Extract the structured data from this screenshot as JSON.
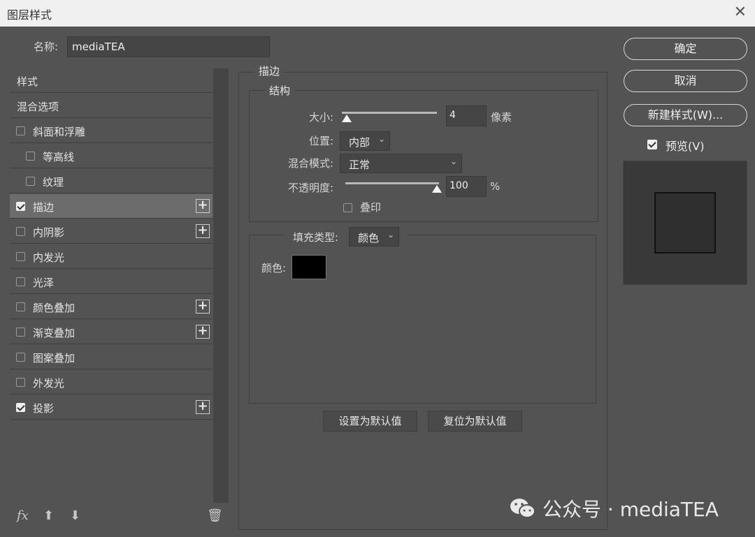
{
  "window": {
    "title": "图层样式",
    "close_glyph": "✕"
  },
  "name_row": {
    "label": "名称:",
    "value": "mediaTEA"
  },
  "style_list": {
    "items": [
      {
        "label": "样式",
        "checkbox": false,
        "checked": false,
        "plus": false,
        "selected": false,
        "indent": 0
      },
      {
        "label": "混合选项",
        "checkbox": false,
        "checked": false,
        "plus": false,
        "selected": false,
        "indent": 0
      },
      {
        "label": "斜面和浮雕",
        "checkbox": true,
        "checked": false,
        "plus": false,
        "selected": false,
        "indent": 0
      },
      {
        "label": "等高线",
        "checkbox": true,
        "checked": false,
        "plus": false,
        "selected": false,
        "indent": 1
      },
      {
        "label": "纹理",
        "checkbox": true,
        "checked": false,
        "plus": false,
        "selected": false,
        "indent": 1
      },
      {
        "label": "描边",
        "checkbox": true,
        "checked": true,
        "plus": true,
        "selected": true,
        "indent": 0
      },
      {
        "label": "内阴影",
        "checkbox": true,
        "checked": false,
        "plus": true,
        "selected": false,
        "indent": 0
      },
      {
        "label": "内发光",
        "checkbox": true,
        "checked": false,
        "plus": false,
        "selected": false,
        "indent": 0
      },
      {
        "label": "光泽",
        "checkbox": true,
        "checked": false,
        "plus": false,
        "selected": false,
        "indent": 0
      },
      {
        "label": "颜色叠加",
        "checkbox": true,
        "checked": false,
        "plus": true,
        "selected": false,
        "indent": 0
      },
      {
        "label": "渐变叠加",
        "checkbox": true,
        "checked": false,
        "plus": true,
        "selected": false,
        "indent": 0
      },
      {
        "label": "图案叠加",
        "checkbox": true,
        "checked": false,
        "plus": false,
        "selected": false,
        "indent": 0
      },
      {
        "label": "外发光",
        "checkbox": true,
        "checked": false,
        "plus": false,
        "selected": false,
        "indent": 0
      },
      {
        "label": "投影",
        "checkbox": true,
        "checked": true,
        "plus": true,
        "selected": false,
        "indent": 0
      }
    ],
    "bottom_icons": {
      "fx": "fx",
      "up": "⬆",
      "down": "⬇",
      "trash": "🗑"
    }
  },
  "stroke_panel": {
    "legend": "描边",
    "structure": {
      "legend": "结构",
      "size_label": "大小:",
      "size_value": "4",
      "size_unit": "像素",
      "position_label": "位置:",
      "position_value": "内部",
      "blend_label": "混合模式:",
      "blend_value": "正常",
      "opacity_label": "不透明度:",
      "opacity_value": "100",
      "opacity_unit": "%",
      "overprint_label": "叠印"
    },
    "fill": {
      "type_label": "填充类型:",
      "type_value": "颜色",
      "color_label": "颜色:",
      "color_hex": "#000000"
    },
    "make_default": "设置为默认值",
    "reset_default": "复位为默认值"
  },
  "right_panel": {
    "ok": "确定",
    "cancel": "取消",
    "new_style": "新建样式(W)...",
    "preview_label": "预览(V)"
  },
  "watermark": {
    "text": "公众号 · mediaTEA"
  }
}
